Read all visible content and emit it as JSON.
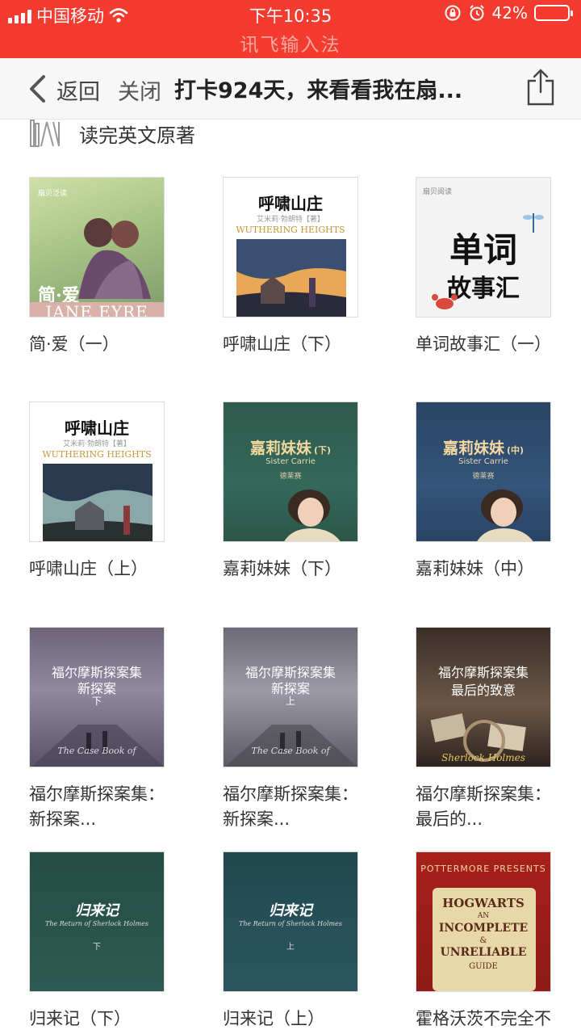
{
  "status_bar": {
    "carrier": "中国移动",
    "time": "下午10:35",
    "battery": "42%",
    "battery_level": 0.42,
    "ime_label": "讯飞输入法"
  },
  "nav": {
    "back_label": "返回",
    "close_label": "关闭",
    "title": "打卡924天，来看看我在扇..."
  },
  "section": {
    "title": "读完英文原著"
  },
  "colors": {
    "status_bar": "#f43b2f",
    "nav_bg": "#f7f7f7"
  },
  "books": [
    {
      "title": "简·爱（一）",
      "cover": {
        "brand": "扇贝泛读",
        "cn": "简·爱",
        "en": "JANE EYRE"
      }
    },
    {
      "title": "呼啸山庄（下）",
      "cover": {
        "cn": "呼啸山庄",
        "author": "艾米莉·勃朗特【著】",
        "en": "WUTHERING HEIGHTS"
      }
    },
    {
      "title": "单词故事汇（一）",
      "cover": {
        "brand": "扇贝阅读",
        "line1": "单词",
        "line2": "故事汇"
      }
    },
    {
      "title": "呼啸山庄（上）",
      "cover": {
        "cn": "呼啸山庄",
        "author": "艾米莉·勃朗特【著】",
        "en": "WUTHERING HEIGHTS"
      }
    },
    {
      "title": "嘉莉妹妹（下）",
      "cover": {
        "cn": "嘉莉妹妹",
        "vol": "(下)",
        "en": "Sister Carrie",
        "author": "德莱赛"
      }
    },
    {
      "title": "嘉莉妹妹（中）",
      "cover": {
        "cn": "嘉莉妹妹",
        "vol": "(中)",
        "en": "Sister Carrie",
        "author": "德莱赛"
      }
    },
    {
      "title": "福尔摩斯探案集：\n新探案...",
      "title_lines": [
        "福尔摩斯探案集：",
        "新探案..."
      ],
      "cover": {
        "line1": "福尔摩斯探案集",
        "line2": "新探案",
        "vol": "下",
        "en": "The Case Book of"
      }
    },
    {
      "title_lines": [
        "福尔摩斯探案集：",
        "新探案..."
      ],
      "cover": {
        "line1": "福尔摩斯探案集",
        "line2": "新探案",
        "vol": "上",
        "en": "The Case Book of"
      }
    },
    {
      "title_lines": [
        "福尔摩斯探案集：",
        "最后的..."
      ],
      "cover": {
        "line1": "福尔摩斯探案集",
        "line2": "最后的致意",
        "en": "Sherlock Holmes"
      }
    },
    {
      "title": "归来记（下）",
      "cover": {
        "cn": "归来记",
        "en": "The Return of Sherlock Holmes",
        "vol": "下"
      }
    },
    {
      "title": "归来记（上）",
      "cover": {
        "cn": "归来记",
        "en": "The Return of Sherlock Holmes",
        "vol": "上"
      }
    },
    {
      "title": "霍格沃茨不完全不",
      "cover": {
        "top": "POTTERMORE PRESENTS",
        "l1": "HOGWARTS",
        "l2": "AN",
        "l3": "INCOMPLETE",
        "l4": "&",
        "l5": "UNRELIABLE",
        "l6": "GUIDE"
      }
    }
  ]
}
